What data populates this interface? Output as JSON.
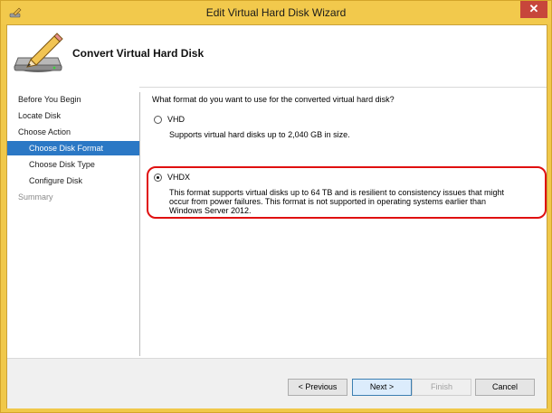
{
  "window": {
    "title": "Edit Virtual Hard Disk Wizard",
    "close_glyph": "✕"
  },
  "header": {
    "title": "Convert Virtual Hard Disk",
    "icon": "disk-pencil-icon"
  },
  "nav": {
    "items": [
      {
        "label": "Before You Begin"
      },
      {
        "label": "Locate Disk"
      },
      {
        "label": "Choose Action"
      },
      {
        "label": "Choose Disk Format"
      },
      {
        "label": "Choose Disk Type"
      },
      {
        "label": "Configure Disk"
      },
      {
        "label": "Summary"
      }
    ]
  },
  "content": {
    "question": "What format do you want to use for the converted virtual hard disk?",
    "options": [
      {
        "label": "VHD",
        "description": "Supports virtual hard disks up to 2,040 GB in size.",
        "selected": false
      },
      {
        "label": "VHDX",
        "description": "This format supports virtual disks up to 64 TB and is resilient to consistency issues that might occur from power failures. This format is not supported in operating systems earlier than Windows Server 2012.",
        "selected": true
      }
    ]
  },
  "footer": {
    "previous": "< Previous",
    "next": "Next >",
    "finish": "Finish",
    "cancel": "Cancel"
  },
  "colors": {
    "selection": "#2b78c5",
    "highlight": "#e01010",
    "titlebar": "#f2c94c"
  }
}
